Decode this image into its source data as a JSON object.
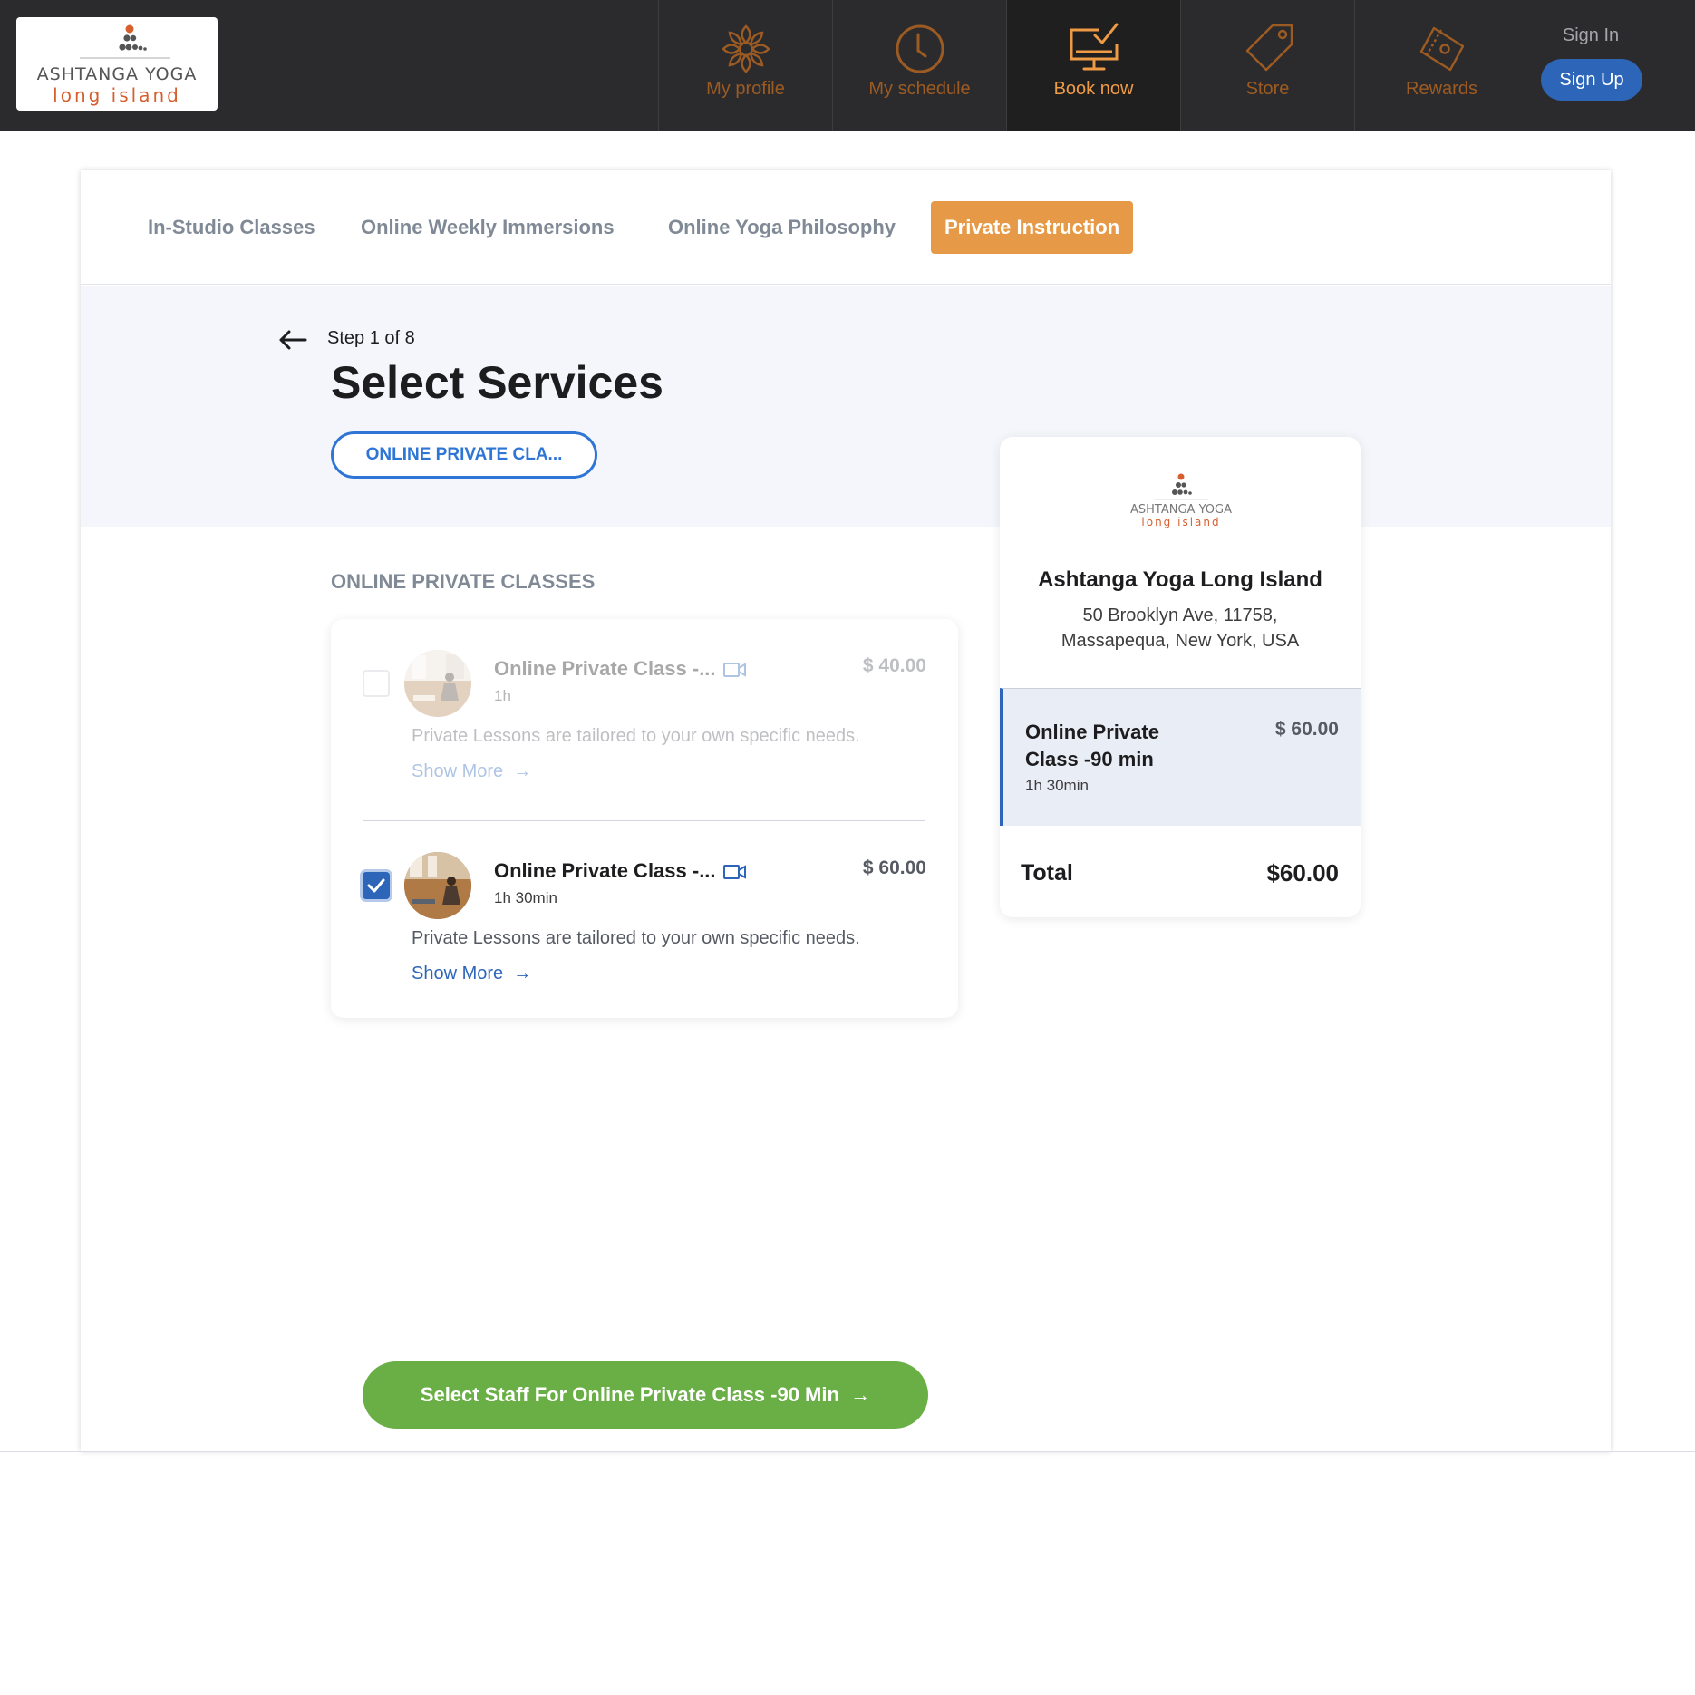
{
  "brand": {
    "logo_line1": "ASHTANGA YOGA",
    "logo_line2": "long island",
    "accent_color": "#e69a47",
    "primary_color": "#2d66b8",
    "success_color": "#6aaf45"
  },
  "nav": {
    "items": [
      {
        "label": "My profile",
        "icon": "mandala-icon"
      },
      {
        "label": "My schedule",
        "icon": "clock-icon"
      },
      {
        "label": "Book now",
        "icon": "monitor-check-icon"
      },
      {
        "label": "Store",
        "icon": "tag-icon"
      },
      {
        "label": "Rewards",
        "icon": "ticket-icon"
      }
    ],
    "active": "Book now",
    "sign_in": "Sign In",
    "sign_up": "Sign Up"
  },
  "tabs": {
    "items": [
      "In-Studio Classes",
      "Online Weekly Immersions",
      "Online Yoga Philosophy",
      "Private Instruction"
    ],
    "active": "Private Instruction"
  },
  "booking": {
    "step": "Step 1 of 8",
    "title": "Select Services",
    "category_pill": "ONLINE PRIVATE CLA...",
    "section_heading": "ONLINE PRIVATE CLASSES",
    "services": [
      {
        "name": "Online Private Class -...",
        "duration": "1h",
        "price": "$ 40.00",
        "description": "Private Lessons are tailored to your own specific needs.",
        "show_more": "Show More",
        "selected": false
      },
      {
        "name": "Online Private Class -...",
        "duration": "1h 30min",
        "price": "$ 60.00",
        "description": "Private Lessons are tailored to your own specific needs.",
        "show_more": "Show More",
        "selected": true
      }
    ],
    "cta": "Select Staff For Online Private Class -90 Min"
  },
  "summary": {
    "studio_name": "Ashtanga Yoga Long Island",
    "address_line1": "50 Brooklyn Ave, 11758,",
    "address_line2": "Massapequa, New York, USA",
    "selected_name": "Online Private Class -90 min",
    "selected_duration": "1h 30min",
    "selected_price": "$ 60.00",
    "total_label": "Total",
    "total_value": "$60.00"
  }
}
